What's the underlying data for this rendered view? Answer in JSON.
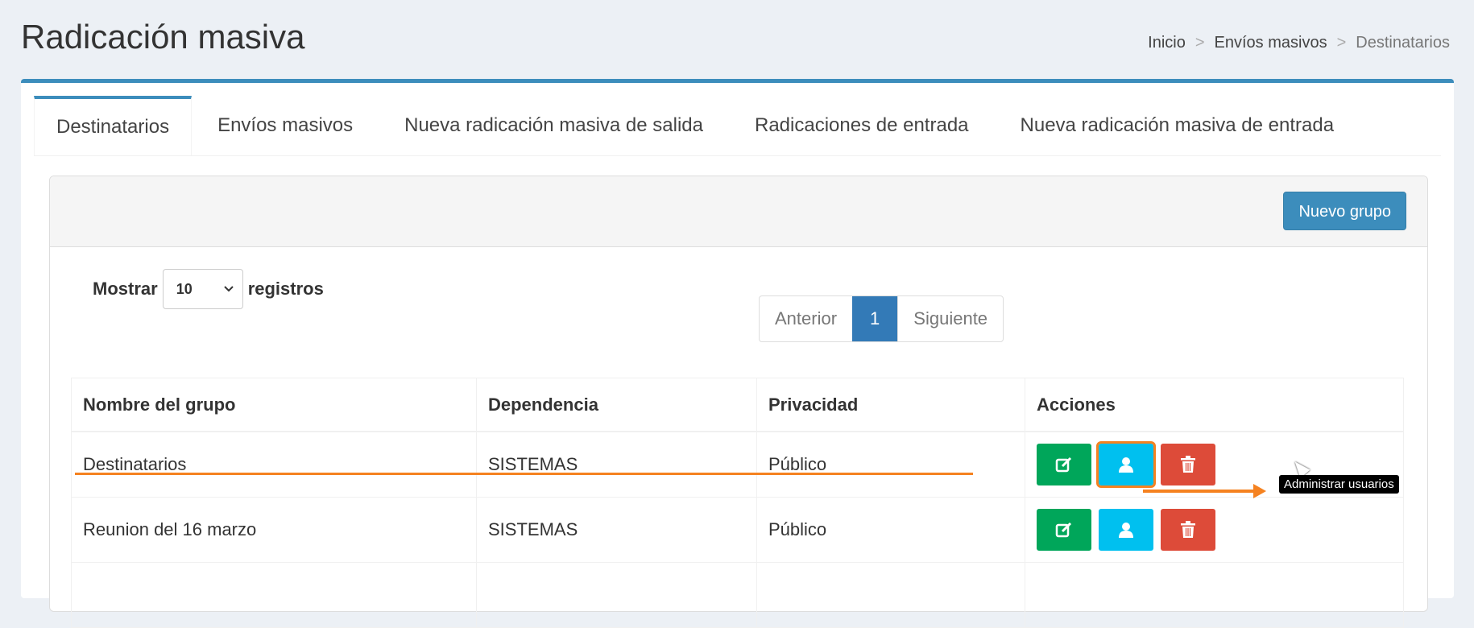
{
  "page": {
    "title": "Radicación masiva"
  },
  "breadcrumb": {
    "items": [
      "Inicio",
      "Envíos masivos",
      "Destinatarios"
    ],
    "separator": ">"
  },
  "tabs": [
    "Destinatarios",
    "Envíos masivos",
    "Nueva radicación masiva de salida",
    "Radicaciones de entrada",
    "Nueva radicación masiva de entrada"
  ],
  "toolbar": {
    "new_group": "Nuevo grupo"
  },
  "length": {
    "prefix": "Mostrar",
    "value": "10",
    "suffix": "registros"
  },
  "pager": {
    "prev": "Anterior",
    "current": "1",
    "next": "Siguiente"
  },
  "table": {
    "headers": [
      "Nombre del grupo",
      "Dependencia",
      "Privacidad",
      "Acciones"
    ],
    "rows": [
      {
        "name": "Destinatarios",
        "dep": "SISTEMAS",
        "priv": "Público"
      },
      {
        "name": "Reunion del 16 marzo",
        "dep": "SISTEMAS",
        "priv": "Público"
      }
    ]
  },
  "tooltip": "Administrar usuarios",
  "icons": {
    "edit": "edit-icon",
    "users": "user-icon",
    "delete": "trash-icon",
    "select": "chevron-down-icon"
  },
  "colors": {
    "primary": "#3c8dbc",
    "success": "#00a65a",
    "info": "#00c0ef",
    "danger": "#dd4b39",
    "annotation": "#f58220"
  }
}
